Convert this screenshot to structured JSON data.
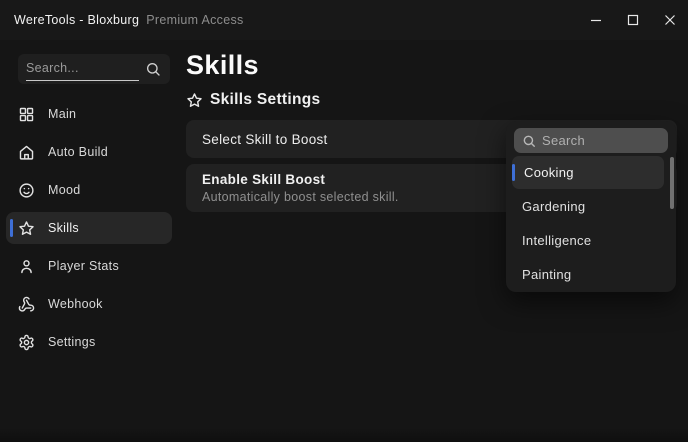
{
  "window": {
    "title": "WereTools - Bloxburg",
    "badge": "Premium Access"
  },
  "sidebar": {
    "search_placeholder": "Search...",
    "items": [
      {
        "label": "Main",
        "icon": "grid-icon",
        "active": false
      },
      {
        "label": "Auto Build",
        "icon": "home-icon",
        "active": false
      },
      {
        "label": "Mood",
        "icon": "smiley-icon",
        "active": false
      },
      {
        "label": "Skills",
        "icon": "star-icon",
        "active": true
      },
      {
        "label": "Player Stats",
        "icon": "user-icon",
        "active": false
      },
      {
        "label": "Webhook",
        "icon": "webhook-icon",
        "active": false
      },
      {
        "label": "Settings",
        "icon": "gear-icon",
        "active": false
      }
    ]
  },
  "main": {
    "title": "Skills",
    "section_title": "Skills Settings",
    "rows": [
      {
        "label": "Select Skill to Boost",
        "value": "Cooking"
      },
      {
        "label": "Enable Skill Boost",
        "description": "Automatically boost selected skill."
      }
    ]
  },
  "dropdown": {
    "search_placeholder": "Search",
    "selected": "Cooking",
    "options": [
      "Cooking",
      "Gardening",
      "Intelligence",
      "Painting"
    ]
  },
  "colors": {
    "accent": "#3e6fd6"
  }
}
